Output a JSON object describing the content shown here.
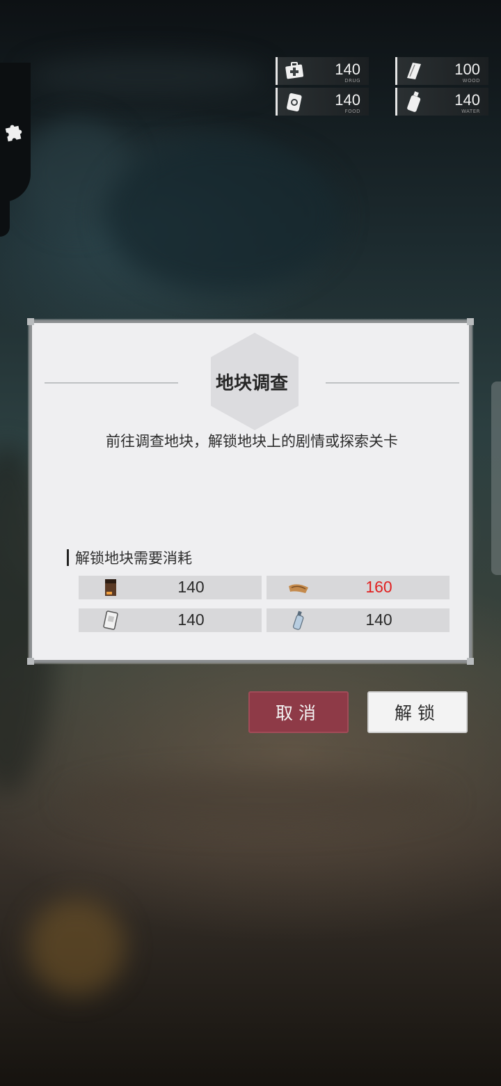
{
  "resources": [
    {
      "name": "drug",
      "value": "140",
      "label": "DRUG",
      "icon": "medkit-icon"
    },
    {
      "name": "wood",
      "value": "100",
      "label": "WOOD",
      "icon": "wood-plank-icon"
    },
    {
      "name": "food",
      "value": "140",
      "label": "FOOD",
      "icon": "food-can-icon"
    },
    {
      "name": "water",
      "value": "140",
      "label": "WATER",
      "icon": "water-bottle-icon"
    }
  ],
  "dialog": {
    "title": "地块调查",
    "description": "前往调查地块，解锁地块上的剧情或探索关卡",
    "cost_heading": "解锁地块需要消耗",
    "costs": [
      {
        "icon": "medicine-box-icon",
        "value": "140",
        "insufficient": false
      },
      {
        "icon": "wood-icon",
        "value": "160",
        "insufficient": true
      },
      {
        "icon": "food-ration-icon",
        "value": "140",
        "insufficient": false
      },
      {
        "icon": "water-bottle-icon",
        "value": "140",
        "insufficient": false
      }
    ],
    "insufficient_color": "#e02020"
  },
  "buttons": {
    "cancel": "取消",
    "unlock": "解锁"
  },
  "colors": {
    "cancel_bg": "#8e3a47",
    "dialog_bg": "#efeff1"
  }
}
